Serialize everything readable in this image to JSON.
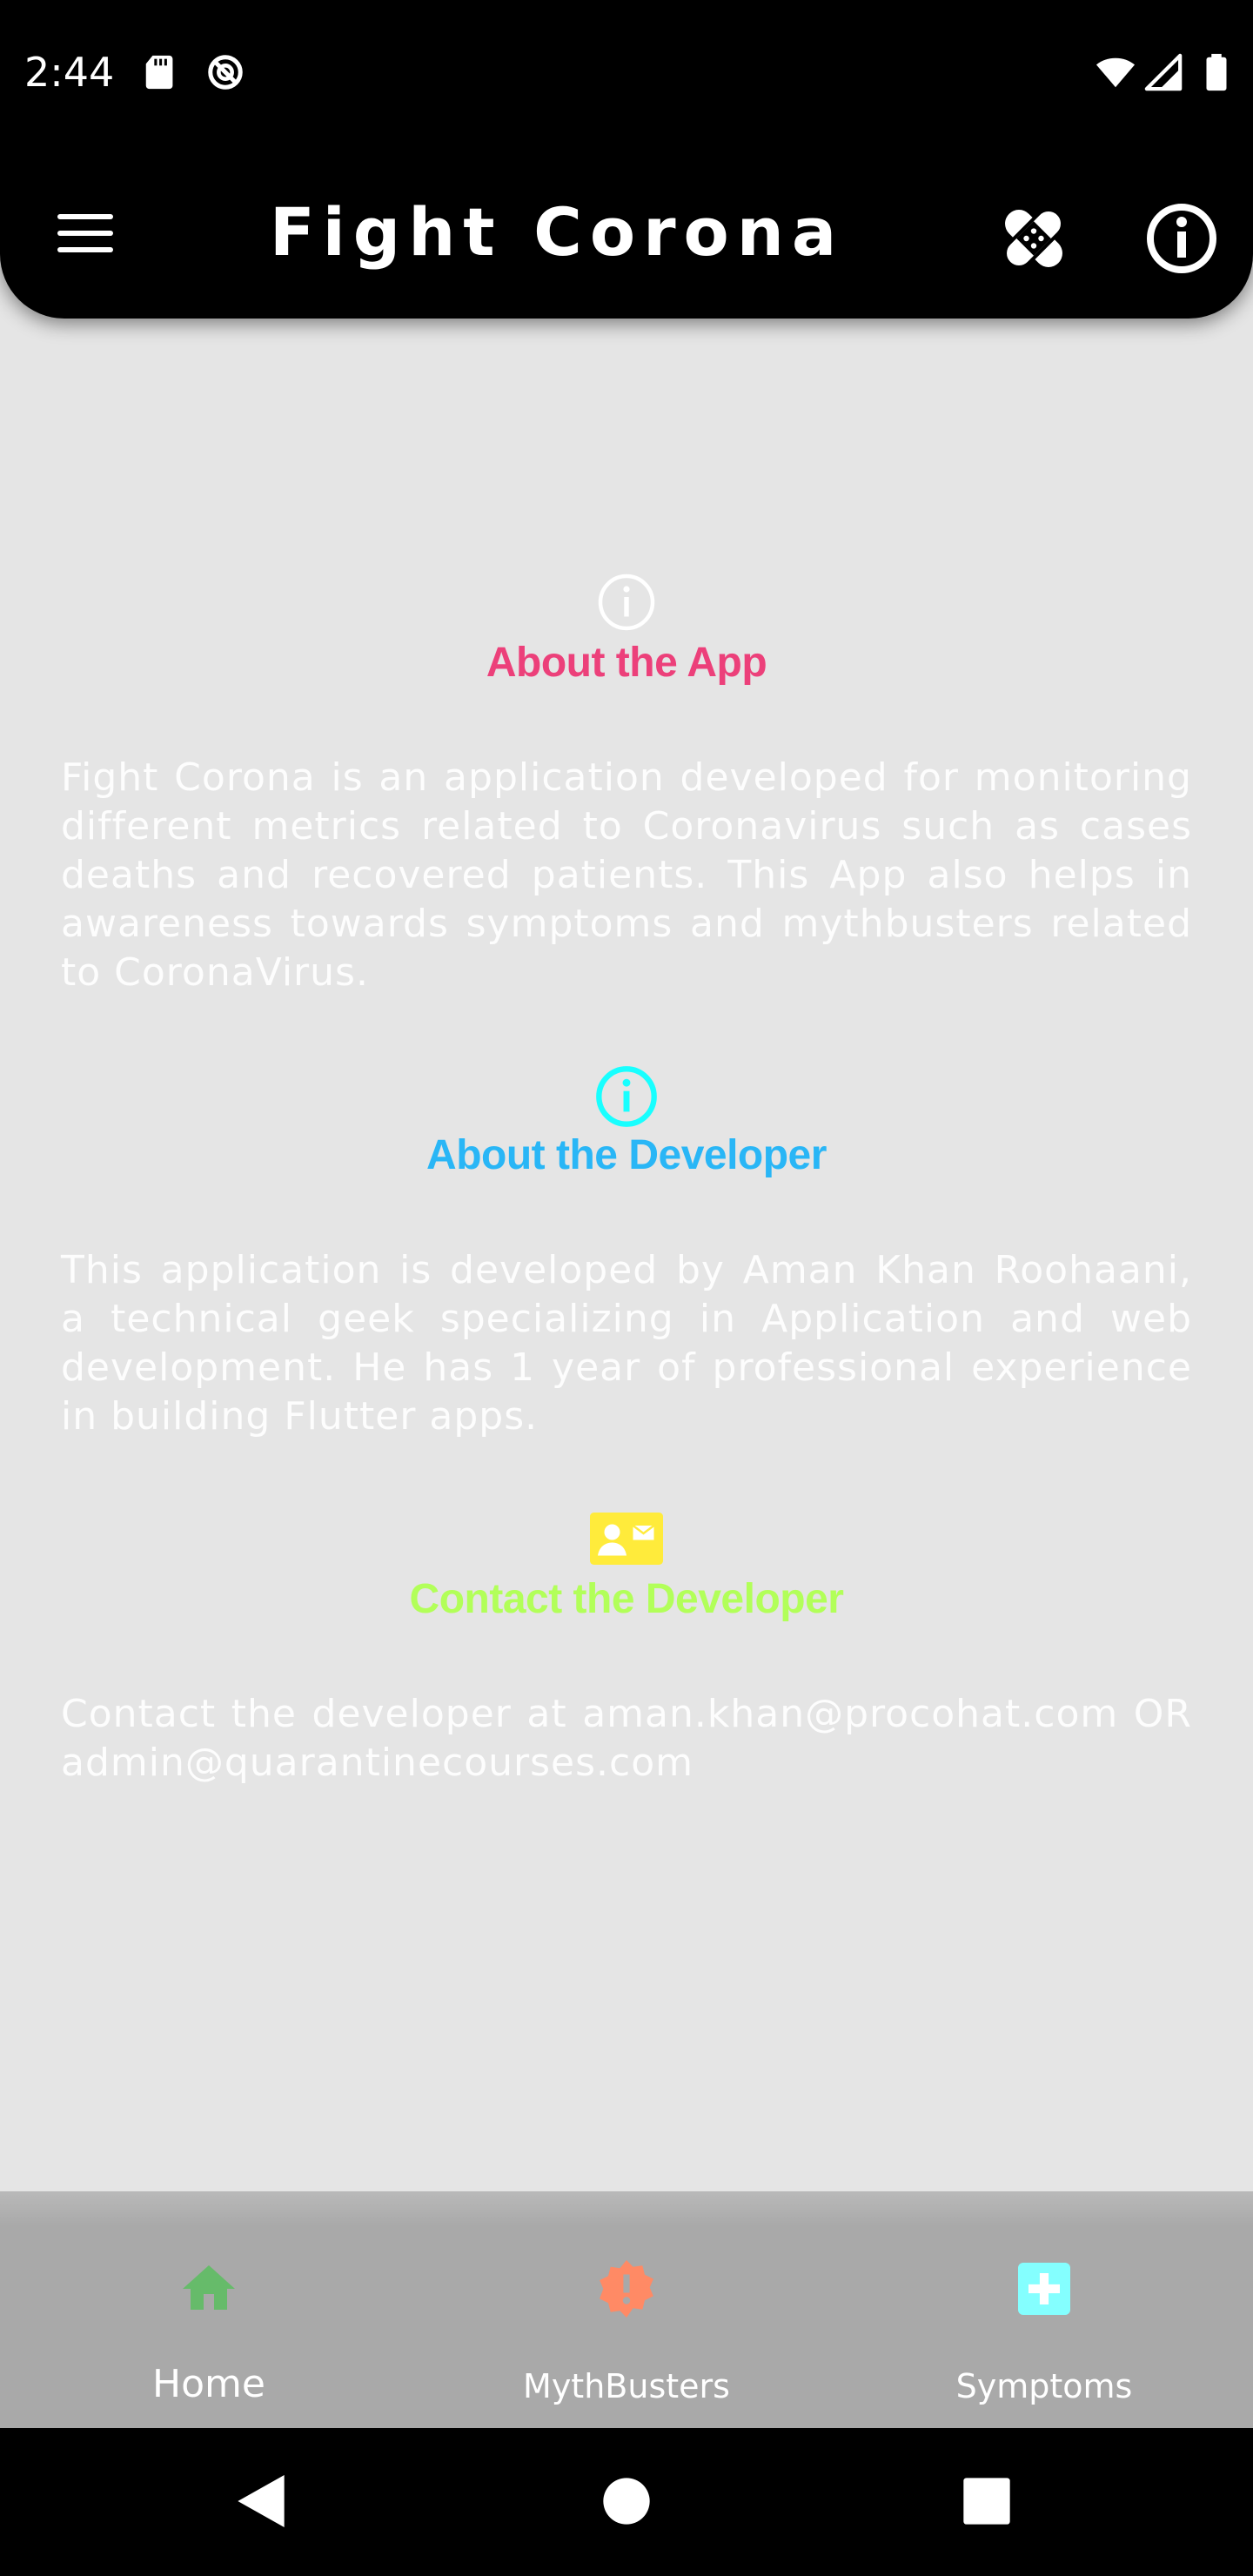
{
  "status_bar": {
    "time": "2:44",
    "left_icons": [
      "sd-card-icon",
      "do-not-disturb-icon"
    ],
    "right_icons": [
      "wifi-icon",
      "cellular-signal-icon",
      "battery-icon"
    ]
  },
  "app_bar": {
    "title": "Fight Corona",
    "menu_icon": "menu-icon",
    "actions": [
      "bandage-icon",
      "info-icon"
    ]
  },
  "sections": [
    {
      "icon": "info-outline-icon",
      "title": "About the App",
      "title_color": "#ec407a",
      "body": "Fight Corona is an application developed for monitoring different metrics related to Coronavirus such as cases deaths and recovered patients. This App also helps in awareness towards symptoms and mythbusters related to CoronaVirus."
    },
    {
      "icon": "info-outline-icon",
      "title": "About the Developer",
      "title_color": "#29b6f6",
      "icon_color": "#18ffff",
      "body": "This application is developed by Aman Khan Roohaani, a technical geek specializing in Application and web development. He has 1 year of professional experience in building Flutter apps."
    },
    {
      "icon": "contact-card-icon",
      "title": "Contact the Developer",
      "title_color": "#b2ff59",
      "icon_color": "#ffeb3b",
      "body": "Contact the developer at aman.khan@procohat.com OR admin@quarantinecourses.com"
    }
  ],
  "bottom_nav": {
    "items": [
      {
        "label": "Home",
        "icon": "home-icon",
        "color": "#66bb6a",
        "selected": true
      },
      {
        "label": "MythBusters",
        "icon": "alert-badge-icon",
        "color": "#ff8a65",
        "selected": false
      },
      {
        "label": "Symptoms",
        "icon": "medical-cross-icon",
        "color": "#84ffff",
        "selected": false
      }
    ]
  },
  "system_nav": [
    "back-icon",
    "home-circle-icon",
    "recents-icon"
  ]
}
